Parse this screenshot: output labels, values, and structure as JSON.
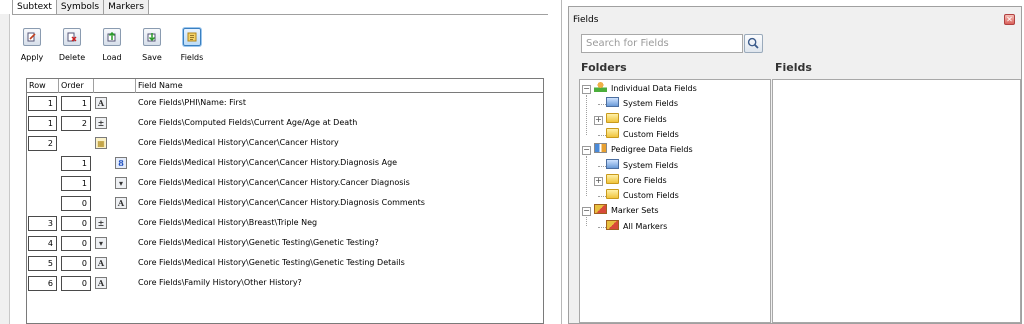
{
  "tabs": [
    {
      "label": "Subtext",
      "active": true
    },
    {
      "label": "Symbols",
      "active": false
    },
    {
      "label": "Markers",
      "active": false
    }
  ],
  "toolbar": {
    "apply": "Apply",
    "delete": "Delete",
    "load": "Load",
    "save": "Save",
    "fields": "Fields"
  },
  "grid": {
    "headers": {
      "row": "Row",
      "order": "Order",
      "type": "",
      "field_name": "Field Name"
    },
    "rows": [
      {
        "row": "1",
        "order": "1",
        "type_icon": "A",
        "field": "Core Fields\\PHI\\Name: First"
      },
      {
        "row": "1",
        "order": "2",
        "type_icon": "calc",
        "field": "Core Fields\\Computed Fields\\Current Age/Age at Death"
      },
      {
        "row": "2",
        "order": "",
        "type_icon": "table",
        "field": "Core Fields\\Medical History\\Cancer\\Cancer History"
      },
      {
        "row": "",
        "order": "1",
        "type_icon": "8",
        "field": "Core Fields\\Medical History\\Cancer\\Cancer History.Diagnosis Age"
      },
      {
        "row": "",
        "order": "1",
        "type_icon": "dropdown",
        "field": "Core Fields\\Medical History\\Cancer\\Cancer History.Cancer Diagnosis"
      },
      {
        "row": "",
        "order": "0",
        "type_icon": "A",
        "field": "Core Fields\\Medical History\\Cancer\\Cancer History.Diagnosis Comments"
      },
      {
        "row": "3",
        "order": "0",
        "type_icon": "calc",
        "field": "Core Fields\\Medical History\\Breast\\Triple Neg"
      },
      {
        "row": "4",
        "order": "0",
        "type_icon": "dropdown",
        "field": "Core Fields\\Medical History\\Genetic Testing\\Genetic Testing?"
      },
      {
        "row": "5",
        "order": "0",
        "type_icon": "A",
        "field": "Core Fields\\Medical History\\Genetic Testing\\Genetic Testing Details"
      },
      {
        "row": "6",
        "order": "0",
        "type_icon": "A",
        "field": "Core Fields\\Family History\\Other History?"
      }
    ]
  },
  "fields_panel": {
    "title": "Fields",
    "close_icon": "close-icon",
    "search_placeholder": "Search for Fields",
    "folders_header": "Folders",
    "fields_header": "Fields",
    "tree": [
      {
        "label": "Individual Data Fields",
        "icon": "person-icon",
        "expander": "-"
      },
      {
        "label": "System Fields",
        "icon": "monitor-icon",
        "expander": ""
      },
      {
        "label": "Core Fields",
        "icon": "folder-icon",
        "expander": "+"
      },
      {
        "label": "Custom Fields",
        "icon": "folder-icon",
        "expander": ""
      },
      {
        "label": "Pedigree Data Fields",
        "icon": "pedigree-icon",
        "expander": "-"
      },
      {
        "label": "System Fields",
        "icon": "monitor-icon",
        "expander": ""
      },
      {
        "label": "Core Fields",
        "icon": "folder-icon",
        "expander": "+"
      },
      {
        "label": "Custom Fields",
        "icon": "folder-icon",
        "expander": ""
      },
      {
        "label": "Marker Sets",
        "icon": "marker-icon",
        "expander": "-"
      },
      {
        "label": "All Markers",
        "icon": "marker-icon",
        "expander": ""
      }
    ]
  }
}
